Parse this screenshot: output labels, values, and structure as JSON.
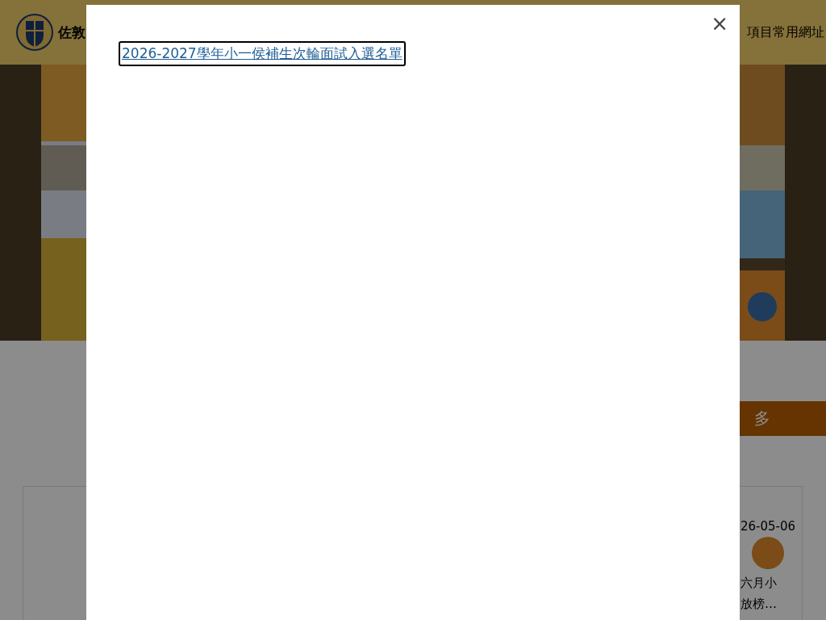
{
  "header": {
    "school_name": "佐敦",
    "nav_item": "項目常用網址"
  },
  "more_button": "多",
  "news_card": {
    "date": "26-05-06",
    "title_lines": [
      "六月小",
      "放榜…"
    ]
  },
  "modal": {
    "link": "2026-2027學年小一侯補生次輪面試入選名單",
    "close": "×"
  }
}
